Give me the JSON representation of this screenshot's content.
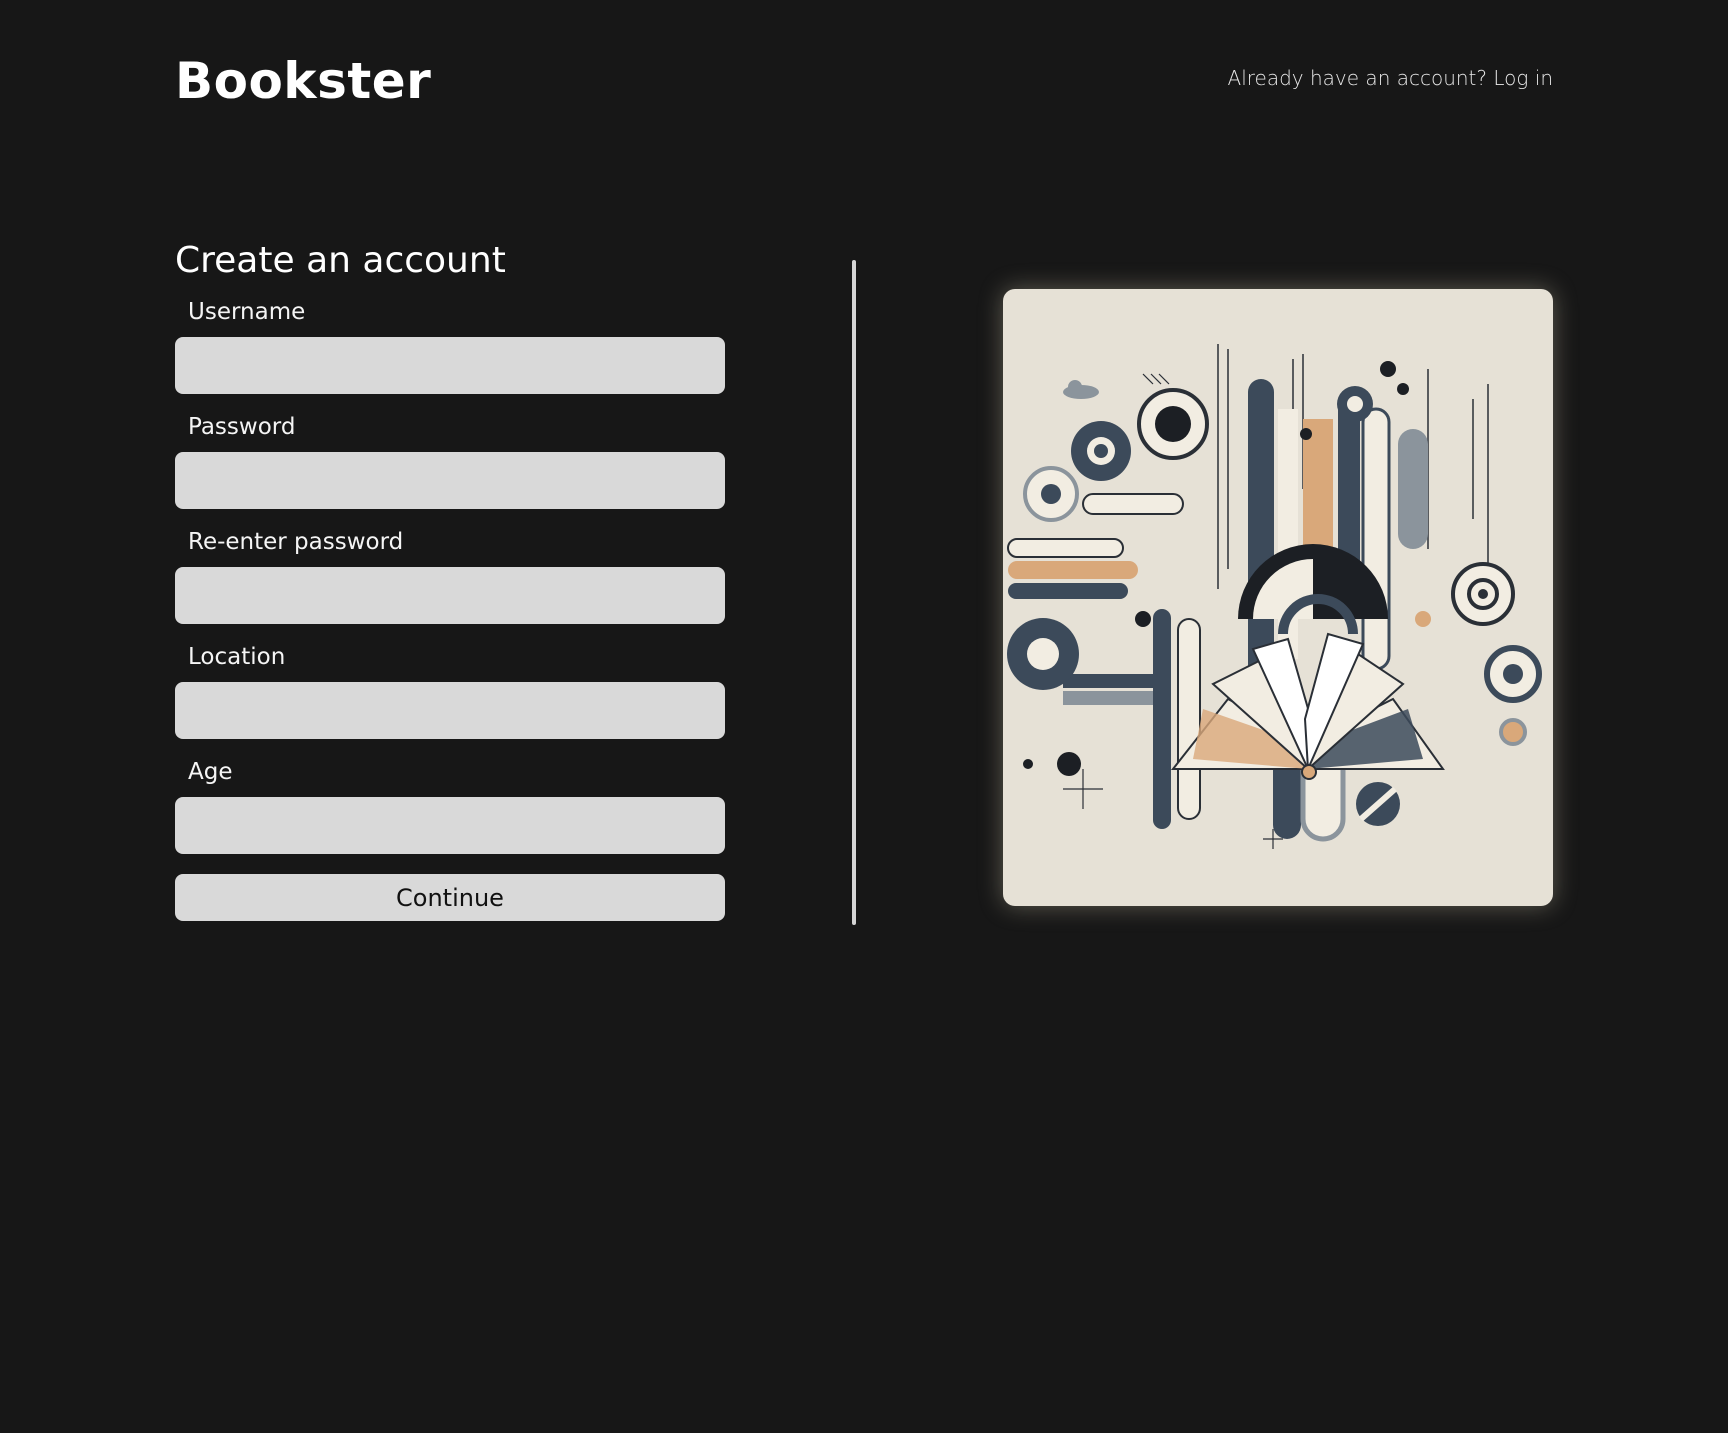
{
  "header": {
    "logo": "Bookster",
    "login_prompt": "Already have an account? Log in"
  },
  "form": {
    "title": "Create an account",
    "fields": [
      {
        "label": "Username",
        "value": ""
      },
      {
        "label": "Password",
        "value": ""
      },
      {
        "label": "Re-enter password",
        "value": ""
      },
      {
        "label": "Location",
        "value": ""
      },
      {
        "label": "Age",
        "value": ""
      }
    ],
    "continue_label": "Continue"
  },
  "colors": {
    "background": "#171717",
    "input_bg": "#d9d9d9",
    "card_bg": "#e6e1d6",
    "art_navy": "#3c4a5a",
    "art_peach": "#d9a87a",
    "art_cream": "#f2ede2"
  }
}
